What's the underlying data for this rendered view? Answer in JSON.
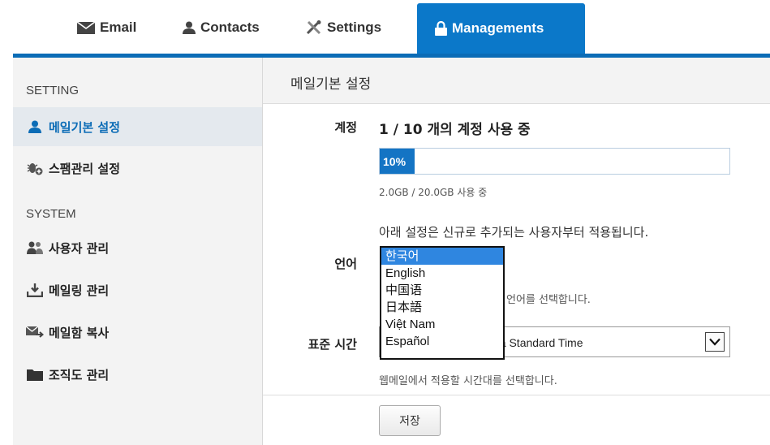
{
  "tabs": [
    {
      "label": "Email",
      "icon": "envelope-icon"
    },
    {
      "label": "Contacts",
      "icon": "person-icon"
    },
    {
      "label": "Settings",
      "icon": "tools-icon"
    },
    {
      "label": "Managements",
      "icon": "lock-icon"
    }
  ],
  "sidebar": {
    "section_setting": "SETTING",
    "setting_items": [
      {
        "label": "메일기본 설정",
        "icon": "person-icon"
      },
      {
        "label": "스팸관리 설정",
        "icon": "bug-plus-icon"
      }
    ],
    "section_system": "SYSTEM",
    "system_items": [
      {
        "label": "사용자 관리",
        "icon": "users-icon"
      },
      {
        "label": "메일링 관리",
        "icon": "download-tray-icon"
      },
      {
        "label": "메일함 복사",
        "icon": "mail-forward-icon"
      },
      {
        "label": "조직도 관리",
        "icon": "folder-icon"
      }
    ]
  },
  "main": {
    "title": "메일기본 설정",
    "account": {
      "label": "계정",
      "usage": "1 / 10 개의 계정 사용 중",
      "progress_text": "10%",
      "progress_fraction": 0.1,
      "storage": "2.0GB / 20.0GB 사용 중"
    },
    "notice": "아래 설정은 신규로 추가되는 사용자부터 적용됩니다.",
    "language": {
      "label": "언어",
      "options": [
        "한국어",
        "English",
        "中国语",
        "日本語",
        "Việt Nam",
        "Español"
      ],
      "selected_index": 0,
      "help_partial": "언어를 선택합니다."
    },
    "timezone": {
      "label": "표준 시간",
      "value_partial": "ea Standard Time",
      "help": "웹메일에서 적용할 시간대를 선택합니다."
    },
    "save_label": "저장"
  },
  "colors": {
    "accent": "#0b78c9",
    "selected_option": "#2f86e0",
    "sidebar_bg": "#f3f3f3"
  }
}
